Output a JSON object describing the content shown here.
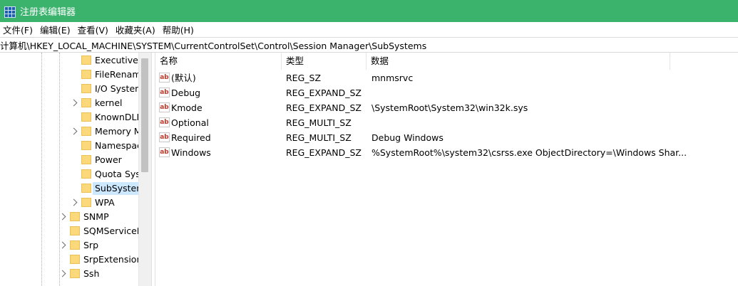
{
  "window": {
    "title": "注册表编辑器"
  },
  "menu": [
    "文件(F)",
    "编辑(E)",
    "查看(V)",
    "收藏夹(A)",
    "帮助(H)"
  ],
  "address": "计算机\\HKEY_LOCAL_MACHINE\\SYSTEM\\CurrentControlSet\\Control\\Session Manager\\SubSystems",
  "tree": [
    {
      "label": "Executive",
      "level": 2,
      "expandable": false,
      "selected": false
    },
    {
      "label": "FileRenam",
      "level": 2,
      "expandable": false,
      "selected": false
    },
    {
      "label": "I/O Systen",
      "level": 2,
      "expandable": false,
      "selected": false
    },
    {
      "label": "kernel",
      "level": 2,
      "expandable": true,
      "selected": false
    },
    {
      "label": "KnownDLL",
      "level": 2,
      "expandable": false,
      "selected": false
    },
    {
      "label": "Memory M",
      "level": 2,
      "expandable": true,
      "selected": false
    },
    {
      "label": "Namespac",
      "level": 2,
      "expandable": false,
      "selected": false
    },
    {
      "label": "Power",
      "level": 2,
      "expandable": false,
      "selected": false
    },
    {
      "label": "Quota Sys",
      "level": 2,
      "expandable": false,
      "selected": false
    },
    {
      "label": "SubSysten",
      "level": 2,
      "expandable": false,
      "selected": true
    },
    {
      "label": "WPA",
      "level": 2,
      "expandable": true,
      "selected": false
    },
    {
      "label": "SNMP",
      "level": 1,
      "expandable": true,
      "selected": false
    },
    {
      "label": "SQMServiceL",
      "level": 1,
      "expandable": false,
      "selected": false
    },
    {
      "label": "Srp",
      "level": 1,
      "expandable": true,
      "selected": false
    },
    {
      "label": "SrpExtension",
      "level": 1,
      "expandable": false,
      "selected": false
    },
    {
      "label": "Ssh",
      "level": 1,
      "expandable": true,
      "selected": false
    }
  ],
  "list": {
    "columns": [
      "名称",
      "类型",
      "数据"
    ],
    "rows": [
      {
        "icon": "ab",
        "name": "(默认)",
        "type": "REG_SZ",
        "data": "mnmsrvc"
      },
      {
        "icon": "ab",
        "name": "Debug",
        "type": "REG_EXPAND_SZ",
        "data": ""
      },
      {
        "icon": "ab",
        "name": "Kmode",
        "type": "REG_EXPAND_SZ",
        "data": "\\SystemRoot\\System32\\win32k.sys"
      },
      {
        "icon": "ab",
        "name": "Optional",
        "type": "REG_MULTI_SZ",
        "data": ""
      },
      {
        "icon": "ab",
        "name": "Required",
        "type": "REG_MULTI_SZ",
        "data": "Debug Windows"
      },
      {
        "icon": "ab",
        "name": "Windows",
        "type": "REG_EXPAND_SZ",
        "data": "%SystemRoot%\\system32\\csrss.exe ObjectDirectory=\\Windows Shar..."
      }
    ]
  }
}
